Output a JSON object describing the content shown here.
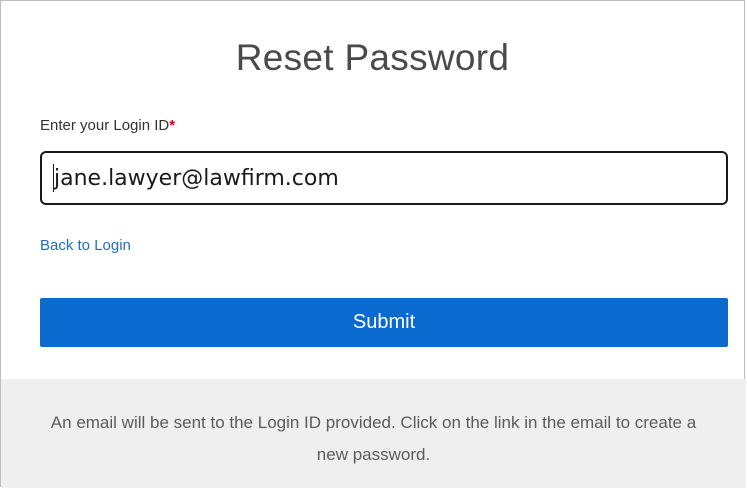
{
  "dialog": {
    "title": "Reset Password"
  },
  "login_field": {
    "label": "Enter your Login ID",
    "required_marker": "*",
    "value": "jane.lawyer@lawfirm.com"
  },
  "links": {
    "back_to_login": "Back to Login"
  },
  "buttons": {
    "submit_label": "Submit"
  },
  "footer": {
    "message": "An email will be sent to the Login ID provided. Click on the link in the email to create a new password."
  },
  "colors": {
    "primary_button": "#0a6ad0",
    "link": "#1f6fbf",
    "required": "#d0021b",
    "footer_background": "#efefef"
  }
}
